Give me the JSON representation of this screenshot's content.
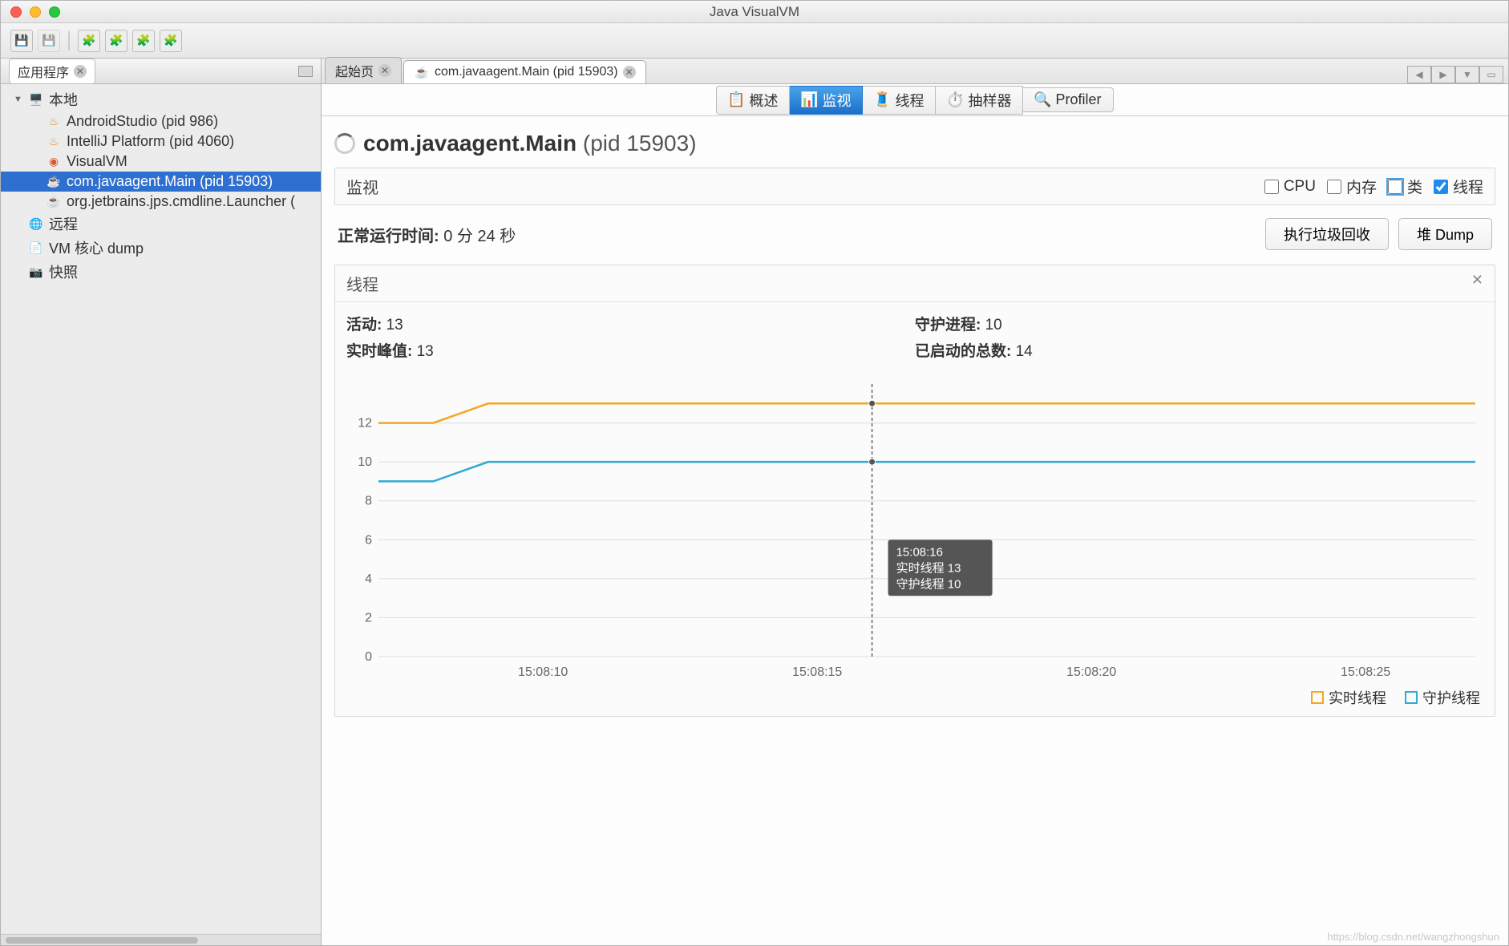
{
  "window_title": "Java VisualVM",
  "sidebar": {
    "tab_label": "应用程序",
    "nodes": {
      "local": "本地",
      "items": [
        {
          "label": "AndroidStudio (pid 986)",
          "icon": "java-icon"
        },
        {
          "label": "IntelliJ Platform (pid 4060)",
          "icon": "java-icon"
        },
        {
          "label": "VisualVM",
          "icon": "visualvm-icon"
        },
        {
          "label": "com.javaagent.Main (pid 15903)",
          "icon": "java-app-icon",
          "selected": true
        },
        {
          "label": "org.jetbrains.jps.cmdline.Launcher (",
          "icon": "java-app-icon"
        }
      ],
      "remote": "远程",
      "coredump": "VM 核心 dump",
      "snapshot": "快照"
    }
  },
  "tabs": {
    "start": "起始页",
    "active": "com.javaagent.Main (pid 15903)"
  },
  "subtabs": {
    "overview": "概述",
    "monitor": "监视",
    "threads": "线程",
    "sampler": "抽样器",
    "profiler": "Profiler"
  },
  "page": {
    "title_main": "com.javaagent.Main",
    "title_pid": "(pid 15903)",
    "monitor_label": "监视",
    "check_cpu": "CPU",
    "check_mem": "内存",
    "check_class": "类",
    "check_thread": "线程",
    "uptime_label": "正常运行时间:",
    "uptime_value": "0 分 24 秒",
    "btn_gc": "执行垃圾回收",
    "btn_dump": "堆 Dump"
  },
  "panel": {
    "title": "线程",
    "live_label": "活动:",
    "live_value": "13",
    "peak_label": "实时峰值:",
    "peak_value": "13",
    "daemon_label": "守护进程:",
    "daemon_value": "10",
    "started_label": "已启动的总数:",
    "started_value": "14"
  },
  "tooltip": {
    "time": "15:08:16",
    "line1_label": "实时线程",
    "line1_value": "13",
    "line2_label": "守护线程",
    "line2_value": "10"
  },
  "legend": {
    "live": "实时线程",
    "daemon": "守护线程"
  },
  "colors": {
    "live": "#f5a623",
    "daemon": "#2eaad6",
    "grid": "#dcdcdc",
    "tooltip_bg": "#555555"
  },
  "chart_data": {
    "type": "line",
    "xlabel": "",
    "ylabel": "",
    "ylim": [
      0,
      14
    ],
    "yticks": [
      0,
      2,
      4,
      6,
      8,
      10,
      12
    ],
    "xticks": [
      "15:08:10",
      "15:08:15",
      "15:08:20",
      "15:08:25"
    ],
    "x": [
      0,
      1,
      2,
      3,
      4,
      5,
      6,
      7,
      8,
      9,
      10,
      11,
      12,
      13,
      14,
      15,
      16,
      17,
      18,
      19,
      20
    ],
    "series": [
      {
        "name": "实时线程",
        "color": "#f5a623",
        "values": [
          12,
          12,
          13,
          13,
          13,
          13,
          13,
          13,
          13,
          13,
          13,
          13,
          13,
          13,
          13,
          13,
          13,
          13,
          13,
          13,
          13
        ]
      },
      {
        "name": "守护线程",
        "color": "#2eaad6",
        "values": [
          9,
          9,
          10,
          10,
          10,
          10,
          10,
          10,
          10,
          10,
          10,
          10,
          10,
          10,
          10,
          10,
          10,
          10,
          10,
          10,
          10
        ]
      }
    ],
    "cursor_x": 9,
    "cursor_values": {
      "实时线程": 13,
      "守护线程": 10
    }
  },
  "watermark": "https://blog.csdn.net/wangzhongshun"
}
